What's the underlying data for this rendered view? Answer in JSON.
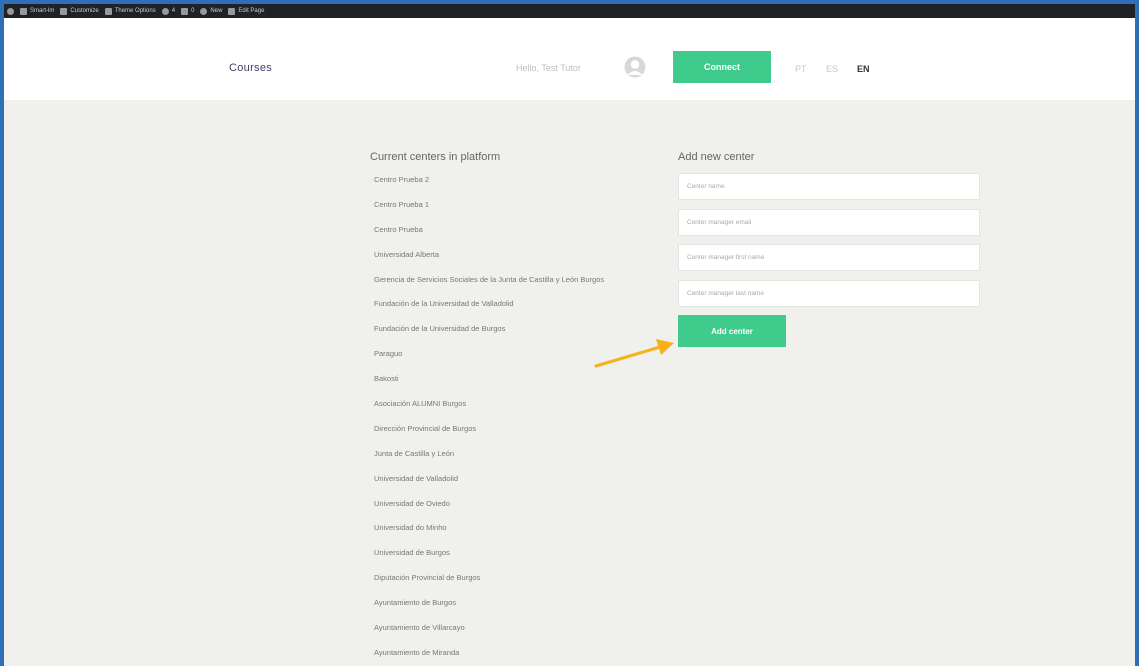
{
  "admin_bar": {
    "items": [
      {
        "icon": "wordpress-icon",
        "label": ""
      },
      {
        "icon": "dashboard-icon",
        "label": "Smart-lm"
      },
      {
        "icon": "pencil-icon",
        "label": "Customize"
      },
      {
        "icon": "menu-icon",
        "label": "Theme Options"
      },
      {
        "icon": "refresh-icon",
        "label": "4"
      },
      {
        "icon": "comment-icon",
        "label": "0"
      },
      {
        "icon": "plus-icon",
        "label": "New"
      },
      {
        "icon": "pencil-icon",
        "label": "Edit Page"
      }
    ]
  },
  "header": {
    "nav_courses": "Courses",
    "greeting": "Hello, Test Tutor",
    "connect_label": "Connect",
    "languages": [
      "PT",
      "ES",
      "EN"
    ],
    "active_language": "EN"
  },
  "centers": {
    "title": "Current centers in platform",
    "items": [
      "Centro Prueba 2",
      "Centro Prueba 1",
      "Centro Prueba",
      "Universidad Alberta",
      "Gerencia de Servicios Sociales de la Junta de Castilla y León Burgos",
      "Fundación de la Universidad de Valladolid",
      "Fundación de la Universidad de Burgos",
      "Paraguo",
      "Bakosti",
      "Asociación ALUMNI Burgos",
      "Dirección Provincial de Burgos",
      "Junta de Castilla y León",
      "Universidad de Valladolid",
      "Universidad de Oviedo",
      "Universidad do Minho",
      "Universidad de Burgos",
      "Diputación Provincial de Burgos",
      "Ayuntamiento de Burgos",
      "Ayuntamiento de Villarcayo",
      "Ayuntamiento de Miranda"
    ]
  },
  "add_center": {
    "title": "Add new center",
    "name_placeholder": "Center name",
    "email_placeholder": "Center manager email",
    "first_name_placeholder": "Center manager first name",
    "last_name_placeholder": "Center manager last name",
    "button_label": "Add center"
  },
  "colors": {
    "accent": "#3ecb8b",
    "arrow": "#f5b21b",
    "frame": "#2f6fb8"
  }
}
